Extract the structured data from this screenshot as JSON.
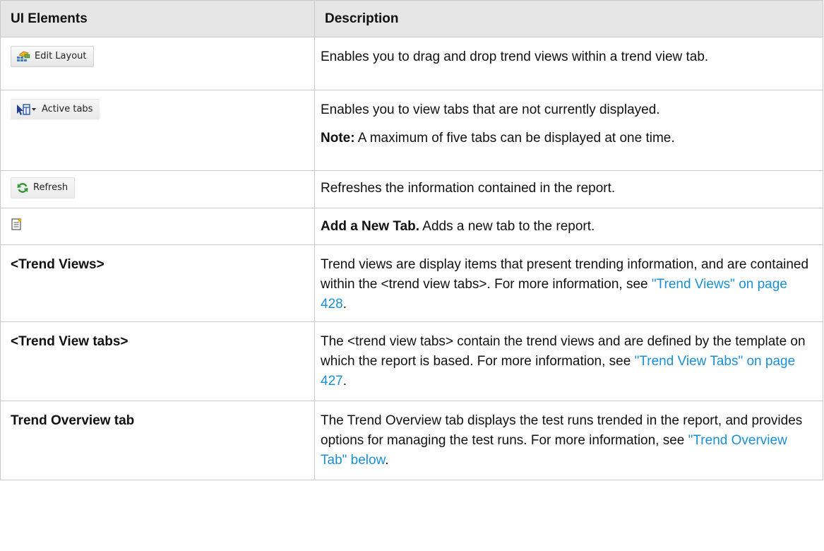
{
  "table": {
    "headers": {
      "col1": "UI Elements",
      "col2": "Description"
    },
    "rows": {
      "edit_layout": {
        "button_label": "Edit Layout",
        "icon": "edit-layout-icon",
        "description": "Enables you to drag and drop trend views within a trend view tab."
      },
      "active_tabs": {
        "button_label": "Active tabs",
        "icon": "active-tabs-icon",
        "description": "Enables you to view tabs that are not currently displayed.",
        "note_label": "Note:",
        "note_text": " A maximum of five tabs can be displayed at one time."
      },
      "refresh": {
        "button_label": "Refresh",
        "icon": "refresh-icon",
        "description": "Refreshes the information contained in the report."
      },
      "add_tab": {
        "icon": "add-new-tab-icon",
        "bold_label": "Add a New Tab.",
        "description": " Adds a new tab to the report."
      },
      "trend_views": {
        "element": "<Trend Views>",
        "description": "Trend views are display items that present trending information, and are contained within the <trend view tabs>. For more information, see ",
        "link_text": "\"Trend Views\" on page 428",
        "tail": "."
      },
      "trend_view_tabs": {
        "element": "<Trend View tabs>",
        "description": "The <trend view tabs> contain the trend views and are defined by the template on which the report is based. For more information, see ",
        "link_text": "\"Trend View Tabs\" on page 427",
        "tail": "."
      },
      "trend_overview": {
        "element": "Trend Overview tab",
        "description": "The Trend Overview tab displays the test runs trended in the report, and provides options for managing the test runs. For more information, see ",
        "link_text": "\"Trend Overview Tab\" below",
        "tail": "."
      }
    }
  },
  "colors": {
    "header_bg": "#e6e6e6",
    "border": "#c8c8c8",
    "link": "#1a8fd6"
  }
}
